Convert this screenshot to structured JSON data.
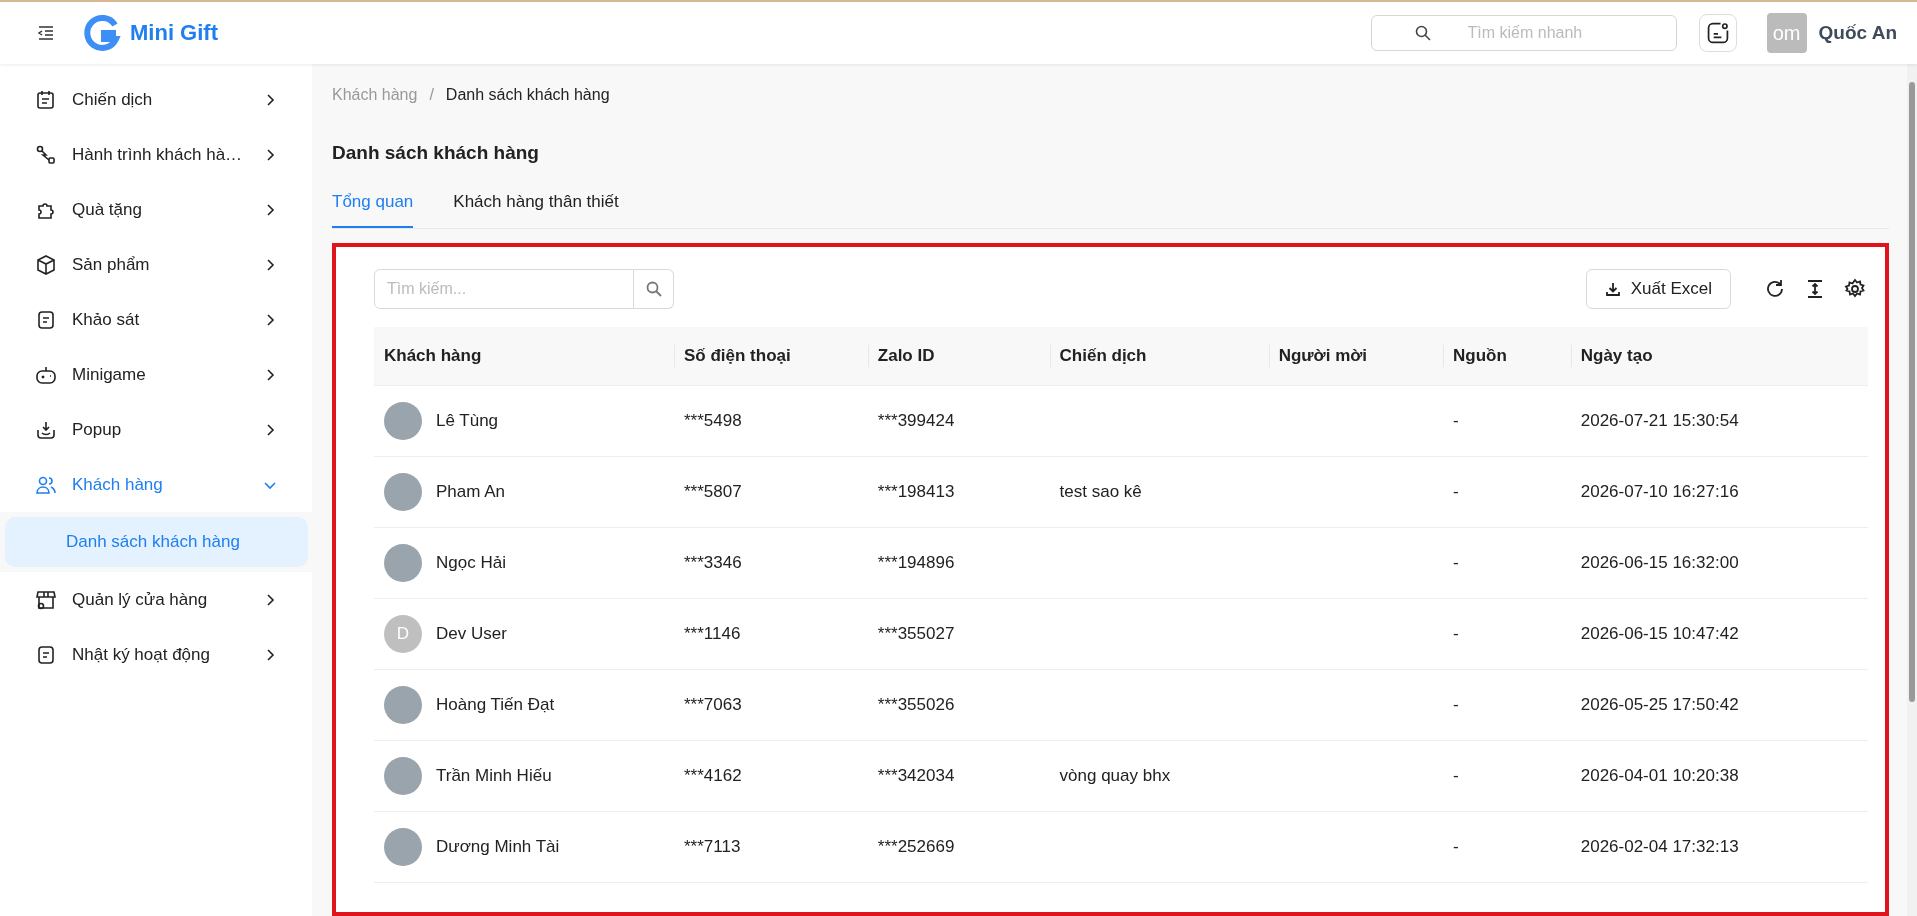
{
  "header": {
    "brand": "Mini Gift",
    "search": {
      "placeholder": "Tìm kiếm nhanh"
    },
    "avatar_text": "om",
    "user_name": "Quốc An"
  },
  "sidebar": {
    "items": [
      {
        "label": "Chiến dịch",
        "expanded": false,
        "selected": false
      },
      {
        "label": "Hành trình khách hà…",
        "expanded": false,
        "selected": false
      },
      {
        "label": "Quà tặng",
        "expanded": false,
        "selected": false
      },
      {
        "label": "Sản phẩm",
        "expanded": false,
        "selected": false
      },
      {
        "label": "Khảo sát",
        "expanded": false,
        "selected": false
      },
      {
        "label": "Minigame",
        "expanded": false,
        "selected": false
      },
      {
        "label": "Popup",
        "expanded": false,
        "selected": false
      },
      {
        "label": "Khách hàng",
        "expanded": true,
        "selected": true,
        "children": [
          {
            "label": "Danh sách khách hàng",
            "selected": true
          }
        ]
      },
      {
        "label": "Quản lý cửa hàng",
        "expanded": false,
        "selected": false
      },
      {
        "label": "Nhật ký hoạt động",
        "expanded": false,
        "selected": false
      }
    ]
  },
  "breadcrumb": {
    "items": [
      "Khách hàng",
      "Danh sách khách hàng"
    ],
    "separator": "/"
  },
  "page_title": "Danh sách khách hàng",
  "tabs": [
    {
      "label": "Tổng quan",
      "selected": true
    },
    {
      "label": "Khách hàng thân thiết",
      "selected": false
    }
  ],
  "toolbar": {
    "search": {
      "placeholder": "Tìm kiếm..."
    },
    "export_button": "Xuất Excel"
  },
  "table": {
    "columns": [
      "Khách hàng",
      "Số điện thoại",
      "Zalo ID",
      "Chiến dịch",
      "Người mời",
      "Nguồn",
      "Ngày tạo"
    ],
    "rows": [
      {
        "avatar": {
          "kind": "photo"
        },
        "name": "Lê Tùng",
        "phone": "***5498",
        "zalo_id": "***399424",
        "campaign": "",
        "inviter": "",
        "source": "-",
        "created": "2026-07-21 15:30:54"
      },
      {
        "avatar": {
          "kind": "photo"
        },
        "name": "Pham An",
        "phone": "***5807",
        "zalo_id": "***198413",
        "campaign": "test sao kê",
        "inviter": "",
        "source": "-",
        "created": "2026-07-10 16:27:16"
      },
      {
        "avatar": {
          "kind": "photo"
        },
        "name": "Ngọc Hải",
        "phone": "***3346",
        "zalo_id": "***194896",
        "campaign": "",
        "inviter": "",
        "source": "-",
        "created": "2026-06-15 16:32:00"
      },
      {
        "avatar": {
          "kind": "letter",
          "letter": "D"
        },
        "name": "Dev User",
        "phone": "***1146",
        "zalo_id": "***355027",
        "campaign": "",
        "inviter": "",
        "source": "-",
        "created": "2026-06-15 10:47:42"
      },
      {
        "avatar": {
          "kind": "photo"
        },
        "name": "Hoàng Tiến Đạt",
        "phone": "***7063",
        "zalo_id": "***355026",
        "campaign": "",
        "inviter": "",
        "source": "-",
        "created": "2026-05-25 17:50:42"
      },
      {
        "avatar": {
          "kind": "photo"
        },
        "name": "Trần Minh Hiếu",
        "phone": "***4162",
        "zalo_id": "***342034",
        "campaign": "vòng quay bhx",
        "inviter": "",
        "source": "-",
        "created": "2026-04-01 10:20:38"
      },
      {
        "avatar": {
          "kind": "photo"
        },
        "name": "Dương Minh Tài",
        "phone": "***7113",
        "zalo_id": "***252669",
        "campaign": "",
        "inviter": "",
        "source": "-",
        "created": "2026-02-04 17:32:13"
      }
    ]
  }
}
